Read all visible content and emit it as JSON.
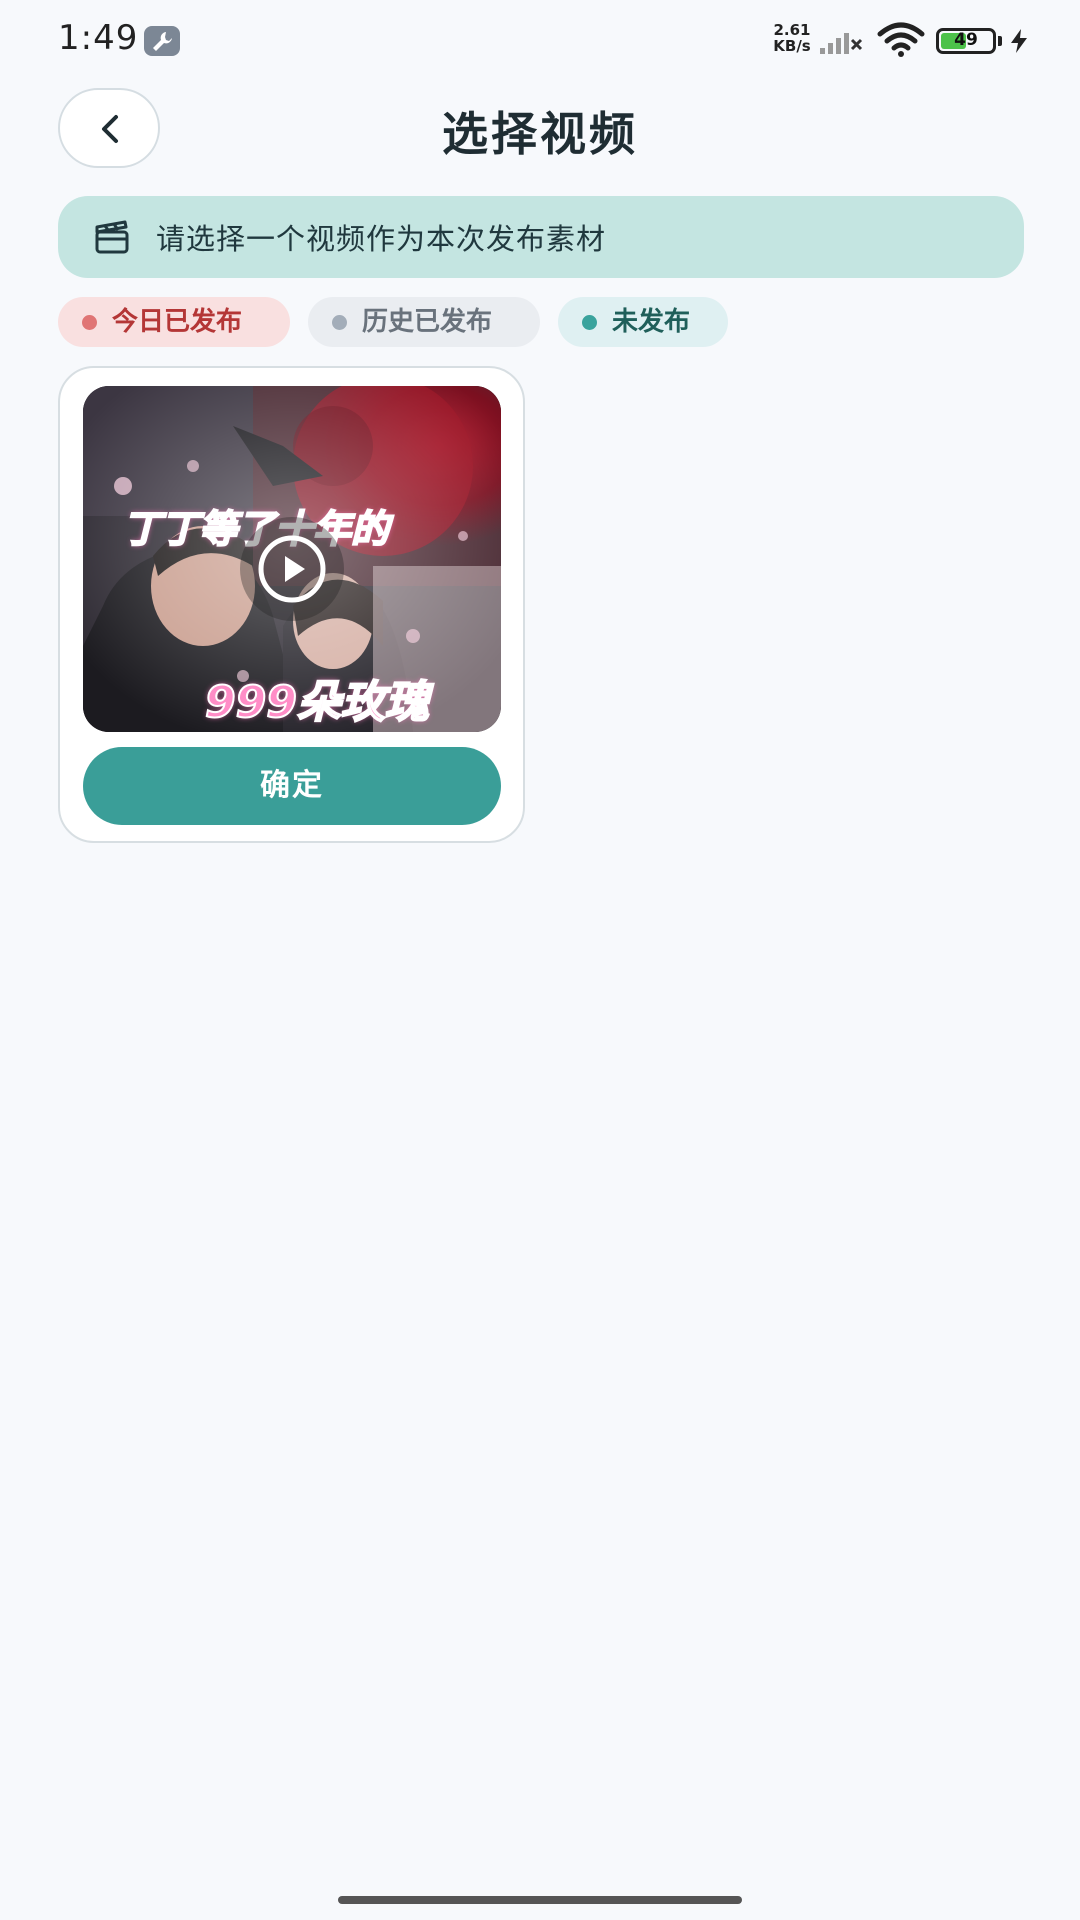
{
  "status_bar": {
    "time": "1:49",
    "net_speed_value": "2.61",
    "net_speed_unit": "KB/s",
    "battery_level": "49",
    "battery_fraction": 0.49
  },
  "header": {
    "title": "选择视频",
    "back_icon": "chevron-left-icon"
  },
  "banner": {
    "text": "请选择一个视频作为本次发布素材",
    "icon": "clapperboard-icon"
  },
  "filters": [
    {
      "label": "今日已发布",
      "color": "#e07575"
    },
    {
      "label": "历史已发布",
      "color": "#a3adb9"
    },
    {
      "label": "未发布",
      "color": "#3aa39d"
    }
  ],
  "videos": [
    {
      "caption_top": "丁丁等了十年的",
      "caption_bottom": "999朵玫瑰",
      "confirm_label": "确定"
    }
  ],
  "colors": {
    "accent": "#3a9e98",
    "banner_bg": "#c4e5e1",
    "background": "#f7f9fc"
  }
}
